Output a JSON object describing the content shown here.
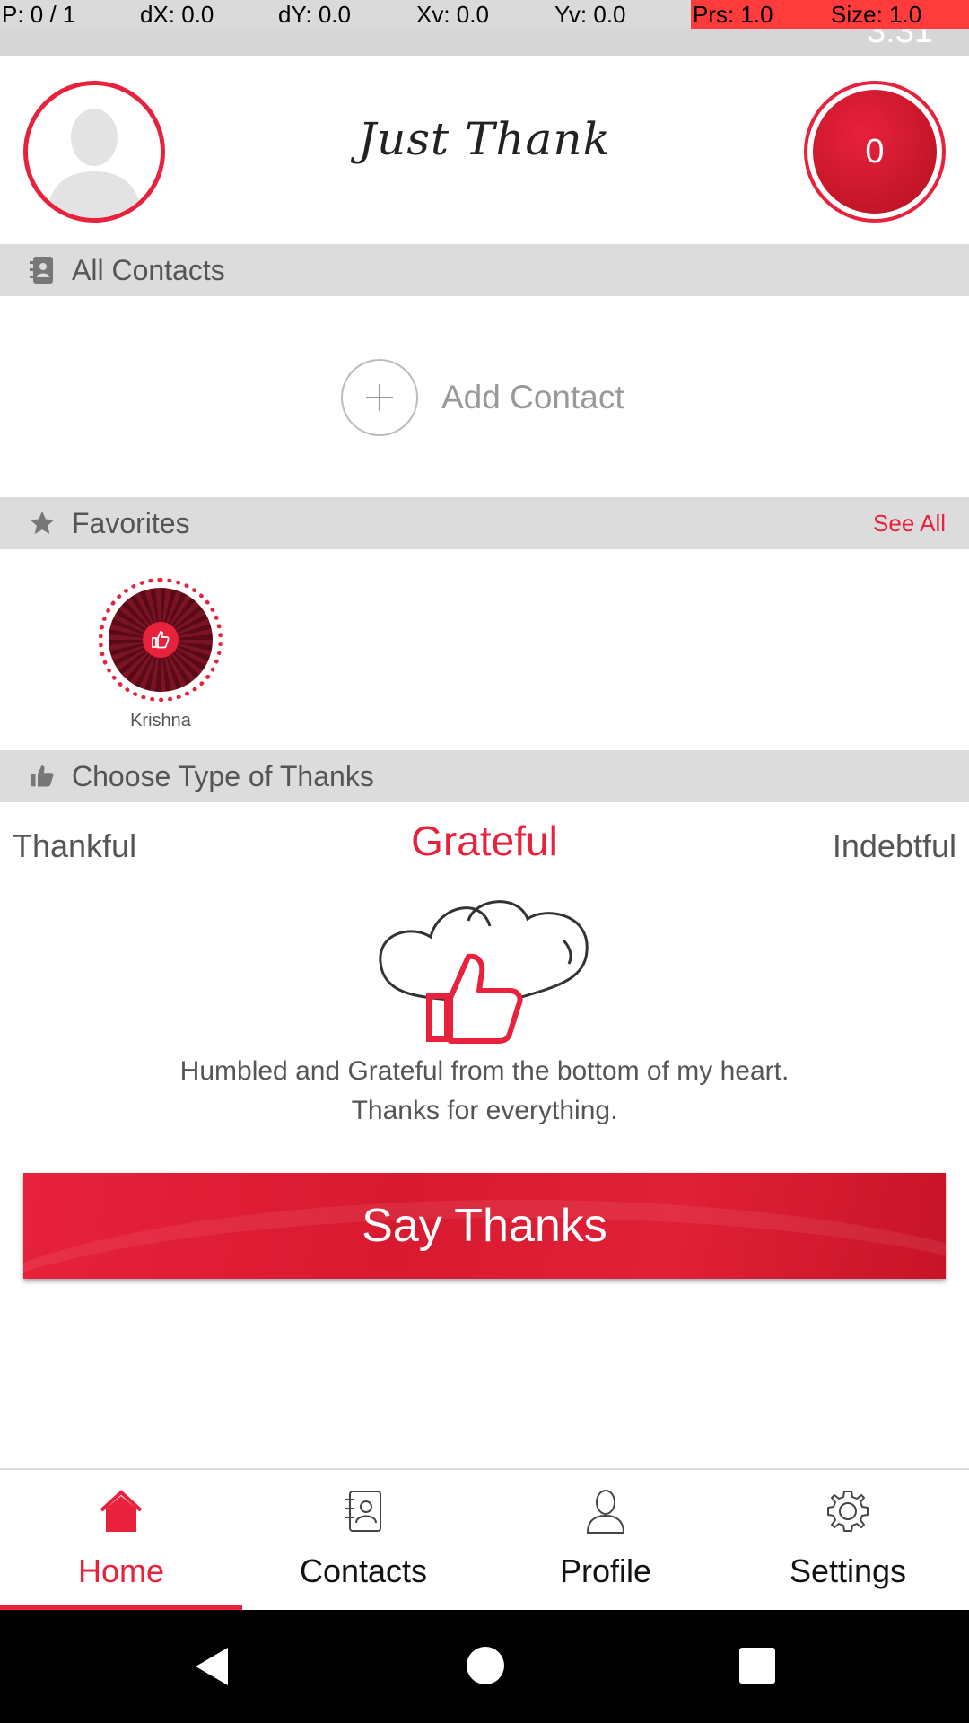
{
  "debug": {
    "p": "P: 0 / 1",
    "dx": "dX: 0.0",
    "dy": "dY: 0.0",
    "xv": "Xv: 0.0",
    "yv": "Yv: 0.0",
    "prs": "Prs: 1.0",
    "size": "Size: 1.0"
  },
  "status_bar": {
    "clock": "3:31"
  },
  "header": {
    "title": "Just Thank",
    "points": "0"
  },
  "sections": {
    "contacts": "All Contacts",
    "favorites": "Favorites",
    "see_all": "See All",
    "thanks_type": "Choose Type of Thanks"
  },
  "add_contact": {
    "label": "Add Contact"
  },
  "favorites": [
    {
      "name": "Krishna"
    }
  ],
  "thanks_types": {
    "left": "Thankful",
    "selected": "Grateful",
    "right": "Indebtful"
  },
  "message": {
    "line1": "Humbled and Grateful from the bottom of my heart.",
    "line2": "Thanks for everything."
  },
  "say_thanks_label": "Say Thanks",
  "bottom_nav": [
    {
      "label": "Home",
      "icon": "home-icon",
      "active": true
    },
    {
      "label": "Contacts",
      "icon": "contacts-book-icon",
      "active": false
    },
    {
      "label": "Profile",
      "icon": "profile-icon",
      "active": false
    },
    {
      "label": "Settings",
      "icon": "gear-icon",
      "active": false
    }
  ],
  "colors": {
    "accent": "#e8213c",
    "section_bg": "#dcdcdc",
    "text_muted": "#555555"
  }
}
